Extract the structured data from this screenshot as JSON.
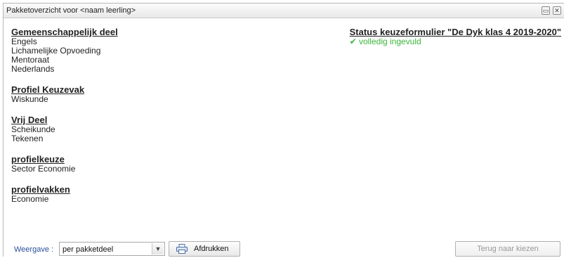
{
  "window": {
    "title": "Pakketoverzicht voor <naam leerling>"
  },
  "sections": [
    {
      "heading": "Gemeenschappelijk deel",
      "items": [
        "Engels",
        "Lichamelijke Opvoeding",
        "Mentoraat",
        "Nederlands"
      ]
    },
    {
      "heading": "Profiel Keuzevak",
      "items": [
        "Wiskunde"
      ]
    },
    {
      "heading": "Vrij Deel",
      "items": [
        "Scheikunde",
        "Tekenen"
      ]
    },
    {
      "heading": "profielkeuze",
      "items": [
        "Sector Economie"
      ]
    },
    {
      "heading": "profielvakken",
      "items": [
        "Economie"
      ]
    }
  ],
  "status": {
    "title": "Status keuzeformulier \"De Dyk klas 4 2019-2020\"",
    "text": "volledig ingevuld",
    "color": "#3cb53c",
    "icon": "checkmark-icon"
  },
  "footer": {
    "weergave_label": "Weergave :",
    "weergave_value": "per pakketdeel",
    "print_label": "Afdrukken",
    "back_label": "Terug naar kiezen"
  }
}
